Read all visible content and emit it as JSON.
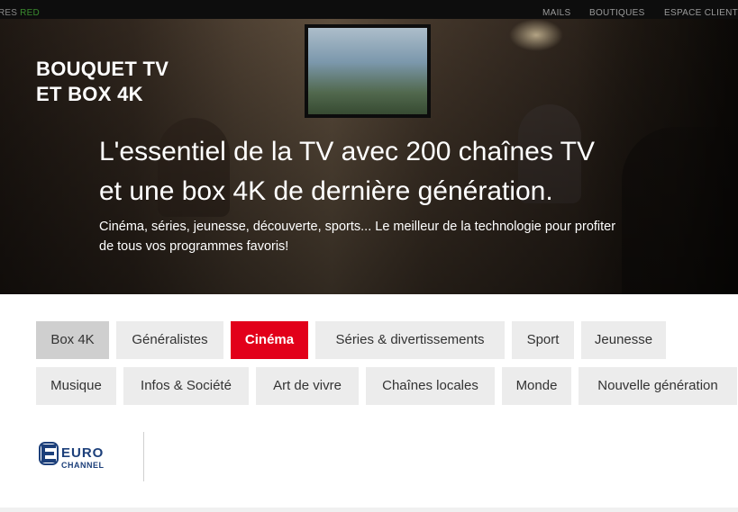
{
  "topbar": {
    "left_text": "RES",
    "left_text_accent": "RED",
    "nav": [
      "MAILS",
      "BOUTIQUES",
      "ESPACE CLIENT"
    ]
  },
  "hero": {
    "title_line1": "BOUQUET TV",
    "title_line2": "ET BOX 4K",
    "headline_line1": "L'essentiel de la TV avec 200 chaînes TV",
    "headline_line2": "et une box 4K de dernière génération.",
    "desc_line1": "Cinéma, séries, jeunesse, découverte, sports... Le meilleur de la technologie pour profiter",
    "desc_line2": "de tous vos programmes favoris!"
  },
  "filters": {
    "row1": [
      "Box 4K",
      "Généralistes",
      "Cinéma",
      "Séries & divertissements",
      "Sport",
      "Jeunesse"
    ],
    "row2": [
      "Musique",
      "Infos & Société",
      "Art de vivre",
      "Chaînes locales",
      "Monde",
      "Nouvelle génération"
    ],
    "selected": "Box 4K",
    "active": "Cinéma"
  },
  "channel_logo": {
    "line1": "EURO",
    "line2": "CHANNEL",
    "color": "#1c3f7a"
  },
  "colors": {
    "accent": "#e2001a",
    "chip_bg": "#ececec",
    "chip_selected_bg": "#cfcfcf",
    "topbar_bg": "#0d0d0d"
  }
}
